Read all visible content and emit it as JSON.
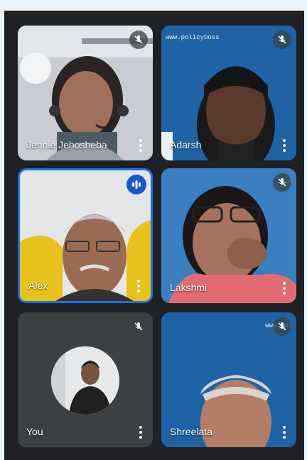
{
  "participants": [
    {
      "name": "Jennie Jehosheba",
      "muted": true
    },
    {
      "name": "Adarsh",
      "muted": true,
      "watermark": "www.policyboss"
    },
    {
      "name": "Alex",
      "muted": false,
      "speaking": true
    },
    {
      "name": "Lakshmi",
      "muted": true,
      "watermark": "ic"
    },
    {
      "name": "You",
      "muted": true
    },
    {
      "name": "Shreelata",
      "muted": true,
      "watermark": "www.pol"
    }
  ],
  "colors": {
    "active_border": "#1a73e8",
    "tile_bg": "#3c4043",
    "app_bg": "#202124"
  },
  "icons": {
    "mute": "mic-off-icon",
    "speaking": "audio-wave-icon",
    "more": "more-vert-icon"
  }
}
